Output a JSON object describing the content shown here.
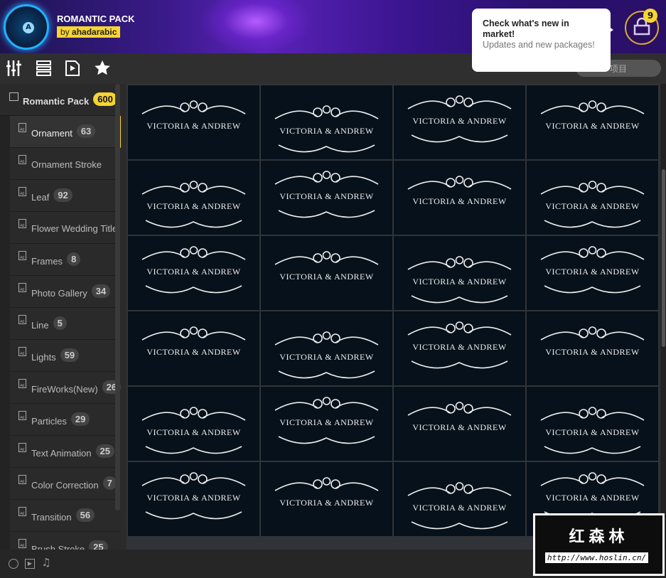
{
  "header": {
    "title": "ROMANTIC PACK",
    "by": "by",
    "author": "ahadarabic"
  },
  "notification": {
    "title": "Check what's new in market!",
    "subtitle": "Updates and new packages!",
    "badge": "9"
  },
  "search": {
    "placeholder": "项目"
  },
  "sidebar": {
    "pack": {
      "label": "Romantic Pack",
      "count": "600"
    },
    "items": [
      {
        "label": "Ornament",
        "count": "63"
      },
      {
        "label": "Ornament Stroke",
        "count": ""
      },
      {
        "label": "Leaf",
        "count": "92"
      },
      {
        "label": "Flower Wedding Title",
        "count": ""
      },
      {
        "label": "Frames",
        "count": "8"
      },
      {
        "label": "Photo Gallery",
        "count": "34"
      },
      {
        "label": "Line",
        "count": "5"
      },
      {
        "label": "Lights",
        "count": "59"
      },
      {
        "label": "FireWorks(New)",
        "count": "26"
      },
      {
        "label": "Particles",
        "count": "29"
      },
      {
        "label": "Text Animation",
        "count": "25"
      },
      {
        "label": "Color Correction",
        "count": "7"
      },
      {
        "label": "Transition",
        "count": "56"
      },
      {
        "label": "Brush Stroke",
        "count": "25"
      }
    ]
  },
  "grid": {
    "caption": "VICTORIA & ANDREW",
    "rows": 6,
    "cols": 4
  },
  "watermark": {
    "name": "红森林",
    "url": "http://www.hoslin.cn/"
  }
}
